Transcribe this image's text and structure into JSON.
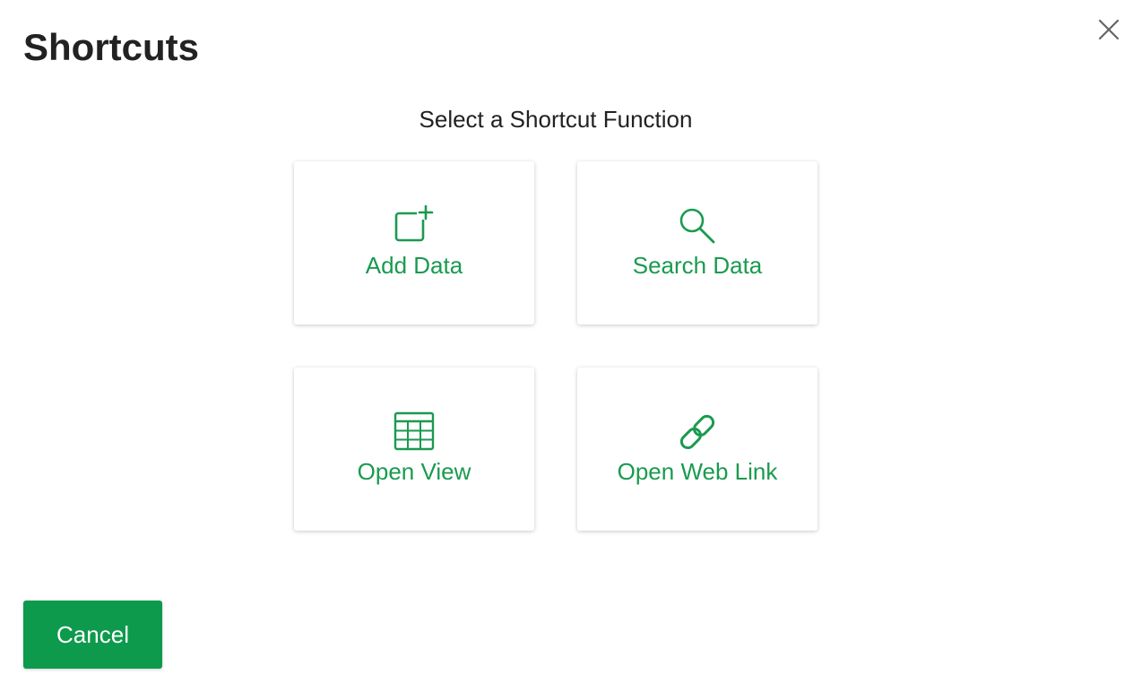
{
  "dialog": {
    "title": "Shortcuts",
    "subtitle": "Select a Shortcut Function",
    "close_icon": "close-icon"
  },
  "shortcuts": [
    {
      "label": "Add Data",
      "icon": "add-square-icon"
    },
    {
      "label": "Search Data",
      "icon": "search-icon"
    },
    {
      "label": "Open View",
      "icon": "table-grid-icon"
    },
    {
      "label": "Open Web Link",
      "icon": "link-icon"
    }
  ],
  "footer": {
    "cancel_label": "Cancel"
  },
  "colors": {
    "accent": "#1a9a4f",
    "button_bg": "#0e9a4c",
    "title_text": "#222222",
    "close_icon": "#666666"
  }
}
